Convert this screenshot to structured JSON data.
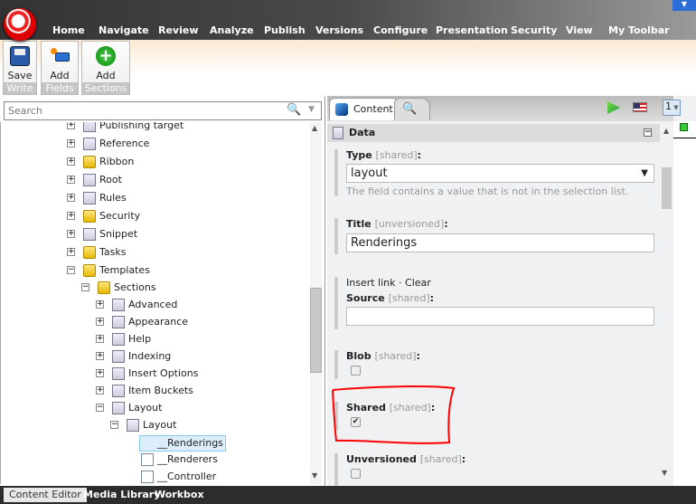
{
  "menu": [
    "Home",
    "Navigate",
    "Review",
    "Analyze",
    "Publish",
    "Versions",
    "Configure",
    "Presentation",
    "Security",
    "View",
    "My Toolbar"
  ],
  "ribbon": {
    "groups": [
      {
        "label": "Save",
        "caption": "Write"
      },
      {
        "label": "Add",
        "caption": "Fields"
      },
      {
        "label": "Add",
        "caption": "Sections"
      }
    ]
  },
  "search": {
    "placeholder": "Search"
  },
  "tree": [
    {
      "label": "Publishing target",
      "level": 0,
      "state": "plus",
      "icon": "publishing-target-icon"
    },
    {
      "label": "Reference",
      "level": 0,
      "state": "plus",
      "icon": "template-icon"
    },
    {
      "label": "Ribbon",
      "level": 0,
      "state": "plus",
      "icon": "folder-icon"
    },
    {
      "label": "Root",
      "level": 0,
      "state": "plus",
      "icon": "template-icon"
    },
    {
      "label": "Rules",
      "level": 0,
      "state": "plus",
      "icon": "rules-icon"
    },
    {
      "label": "Security",
      "level": 0,
      "state": "plus",
      "icon": "folder-icon"
    },
    {
      "label": "Snippet",
      "level": 0,
      "state": "plus",
      "icon": "template-icon"
    },
    {
      "label": "Tasks",
      "level": 0,
      "state": "plus",
      "icon": "folder-icon"
    },
    {
      "label": "Templates",
      "level": 0,
      "state": "minus",
      "icon": "folder-icon"
    },
    {
      "label": "Sections",
      "level": 1,
      "state": "minus",
      "icon": "folder-icon"
    },
    {
      "label": "Advanced",
      "level": 2,
      "state": "plus",
      "icon": "template-icon"
    },
    {
      "label": "Appearance",
      "level": 2,
      "state": "plus",
      "icon": "template-icon"
    },
    {
      "label": "Help",
      "level": 2,
      "state": "plus",
      "icon": "template-icon"
    },
    {
      "label": "Indexing",
      "level": 2,
      "state": "plus",
      "icon": "template-icon"
    },
    {
      "label": "Insert Options",
      "level": 2,
      "state": "plus",
      "icon": "template-icon"
    },
    {
      "label": "Item Buckets",
      "level": 2,
      "state": "plus",
      "icon": "template-icon"
    },
    {
      "label": "Layout",
      "level": 2,
      "state": "minus",
      "icon": "template-icon"
    },
    {
      "label": "Layout",
      "level": 3,
      "state": "minus",
      "icon": "section-icon"
    },
    {
      "label": "__Renderings",
      "level": 4,
      "state": "none",
      "icon": "field-icon",
      "selected": true
    },
    {
      "label": "__Renderers",
      "level": 4,
      "state": "none",
      "icon": "field-icon"
    },
    {
      "label": "__Controller",
      "level": 4,
      "state": "none",
      "icon": "field-icon"
    }
  ],
  "bottom_tabs": [
    "Content Editor",
    "Media Library",
    "Workbox"
  ],
  "editor": {
    "tabs": [
      "Content"
    ],
    "version": "1",
    "section": "Data",
    "type": {
      "label": "Type",
      "scope": "[shared]",
      "value": "layout",
      "note": "The field contains a value that is not in the selection list."
    },
    "title": {
      "label": "Title",
      "scope": "[unversioned]",
      "value": "Renderings"
    },
    "source": {
      "links": [
        "Insert link",
        "Clear"
      ],
      "label": "Source",
      "scope": "[shared]",
      "value": ""
    },
    "blob": {
      "label": "Blob",
      "scope": "[shared]",
      "checked": false
    },
    "shared": {
      "label": "Shared",
      "scope": "[shared]",
      "checked": true
    },
    "unversioned": {
      "label": "Unversioned",
      "scope": "[shared]",
      "checked": false
    }
  },
  "colors": {
    "annotation": "#ff0000",
    "accent": "#2b6fd6"
  }
}
